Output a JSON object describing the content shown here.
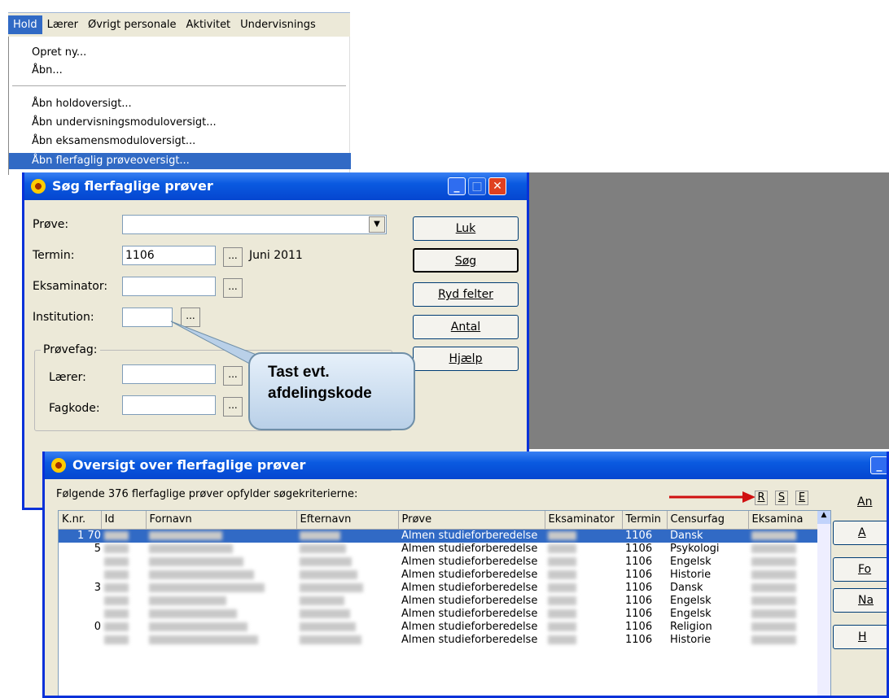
{
  "menubar": [
    "Hold",
    "Lærer",
    "Øvrigt personale",
    "Aktivitet",
    "Undervisnings"
  ],
  "menu": [
    "Opret ny...",
    "Åbn...",
    "Åbn holdoversigt...",
    "Åbn undervisningsmoduloversigt...",
    "Åbn eksamensmoduloversigt...",
    "Åbn flerfaglig prøveoversigt..."
  ],
  "search_dialog": {
    "title": "Søg flerfaglige prøver",
    "labels": {
      "prove": "Prøve:",
      "termin": "Termin:",
      "eksaminator": "Eksaminator:",
      "institution": "Institution:",
      "provefag": "Prøvefag:",
      "laerer": "Lærer:",
      "fagkode": "Fagkode:"
    },
    "termin_value": "1106",
    "termin_text": "Juni 2011",
    "dots": "...",
    "buttons": [
      "Luk",
      "Søg",
      "Ryd felter",
      "Antal",
      "Hjælp"
    ]
  },
  "callout": {
    "line1": "Tast evt.",
    "line2": "afdelingskode"
  },
  "result_dialog": {
    "title": "Oversigt over flerfaglige prøver",
    "summary": "Følgende 376 flerfaglige prøver opfylder søgekriterierne:",
    "rse": [
      "R",
      "S",
      "E"
    ],
    "columns": [
      "K.nr.",
      "Id",
      "Fornavn",
      "Efternavn",
      "Prøve",
      "Eksaminator",
      "Termin",
      "Censurfag",
      "Eksamina"
    ],
    "rows": [
      {
        "knr": "1 70",
        "prove": "Almen studieforberedelse",
        "termin": "1106",
        "fag": "Dansk"
      },
      {
        "knr": "5",
        "prove": "Almen studieforberedelse",
        "termin": "1106",
        "fag": "Psykologi"
      },
      {
        "knr": "",
        "prove": "Almen studieforberedelse",
        "termin": "1106",
        "fag": "Engelsk"
      },
      {
        "knr": "",
        "prove": "Almen studieforberedelse",
        "termin": "1106",
        "fag": "Historie"
      },
      {
        "knr": "3",
        "prove": "Almen studieforberedelse",
        "termin": "1106",
        "fag": "Dansk"
      },
      {
        "knr": "",
        "prove": "Almen studieforberedelse",
        "termin": "1106",
        "fag": "Engelsk"
      },
      {
        "knr": "",
        "prove": "Almen studieforberedelse",
        "termin": "1106",
        "fag": "Engelsk"
      },
      {
        "knr": "0",
        "prove": "Almen studieforberedelse",
        "termin": "1106",
        "fag": "Religion"
      },
      {
        "knr": "",
        "prove": "Almen studieforberedelse",
        "termin": "1106",
        "fag": "Historie"
      }
    ],
    "side_buttons": [
      "An",
      "A",
      "Fo",
      "Na",
      "H"
    ]
  }
}
